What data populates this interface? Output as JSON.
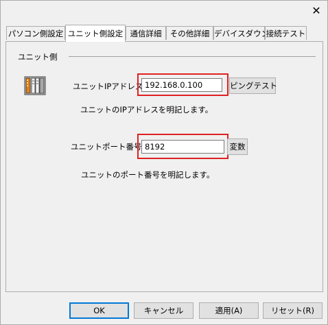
{
  "title_bar": {
    "close_symbol": "✕"
  },
  "tabs": [
    {
      "label": "パソコン側設定",
      "active": false
    },
    {
      "label": "ユニット側設定",
      "active": true
    },
    {
      "label": "通信詳細",
      "active": false
    },
    {
      "label": "その他詳細",
      "active": false
    },
    {
      "label": "デバイスダウン",
      "active": false
    },
    {
      "label": "接続テスト",
      "active": false
    }
  ],
  "group": {
    "title": "ユニット側",
    "icon": "plc-unit-icon"
  },
  "ip": {
    "label": "ユニットIPアドレス：",
    "value": "192.168.0.100",
    "button": "ピングテスト",
    "description": "ユニットのIPアドレスを明記します。"
  },
  "port": {
    "label": "ユニットポート番号：",
    "value": "8192",
    "button": "変数",
    "description": "ユニットのポート番号を明記します。"
  },
  "footer": {
    "ok": "OK",
    "cancel": "キャンセル",
    "apply": "適用(A)",
    "reset": "リセット(R)"
  },
  "colors": {
    "highlight": "#e02020",
    "default_button_border": "#0078d7"
  }
}
